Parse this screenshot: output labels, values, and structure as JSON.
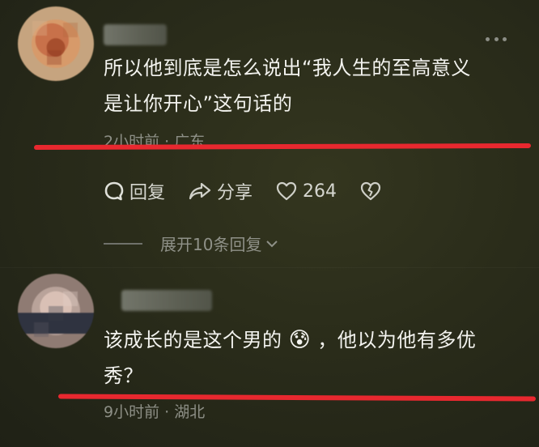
{
  "comments": [
    {
      "text_line1": "所以他到底是怎么说出“我人生的至高意义",
      "text_line2": "是让你开心”这句话的",
      "meta": "2小时前 · 广东"
    },
    {
      "text_before_emoji": "该成长的是这个男的",
      "emoji": "😰",
      "text_after_emoji": "，他以为他有多优",
      "text_line2": "秀？",
      "meta": "9小时前 · 湖北"
    }
  ],
  "actions": {
    "reply_label": "回复",
    "share_label": "分享",
    "like_count": "264"
  },
  "expand_replies": {
    "label": "展开10条回复"
  },
  "colors": {
    "annotation_underline": "#e8282f",
    "background": "#2a2c1a"
  },
  "icons": [
    "more-dots-icon",
    "reply-bubble-icon",
    "share-arrow-icon",
    "heart-icon",
    "broken-heart-icon",
    "chevron-down-icon"
  ]
}
